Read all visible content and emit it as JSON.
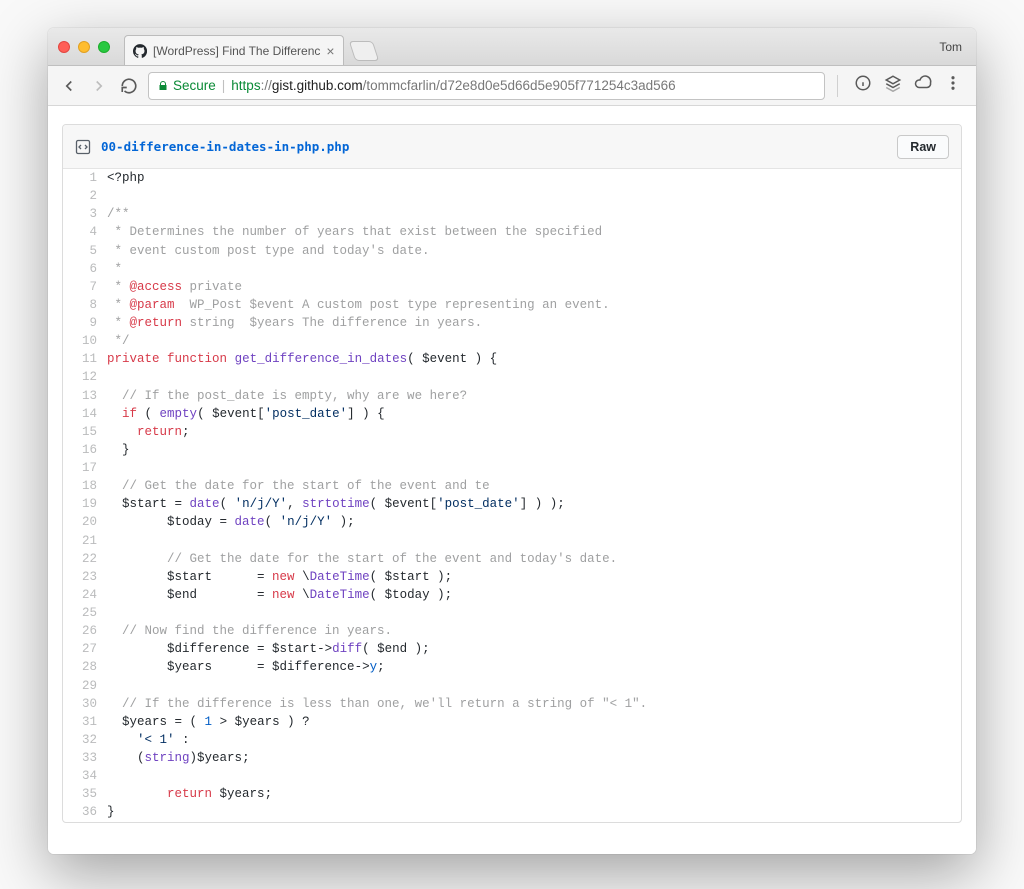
{
  "window": {
    "user_label": "Tom",
    "tabs": [
      {
        "title": "[WordPress] Find The Differenc"
      }
    ]
  },
  "toolbar": {
    "secure_label": "Secure",
    "url_https": "https",
    "url_host": "gist.github.com",
    "url_path": "/tommcfarlin/d72e8d0e5d66d5e905f771254c3ad566"
  },
  "gist": {
    "filename": "00-difference-in-dates-in-php.php",
    "raw_label": "Raw"
  },
  "code": {
    "language": "php",
    "plain": "<?php\n\n/**\n * Determines the number of years that exist between the specified\n * event custom post type and today's date.\n *\n * @access private\n * @param  WP_Post $event A custom post type representing an event.\n * @return string  $years The difference in years.\n */\nprivate function get_difference_in_dates( $event ) {\n\n  // If the post_date is empty, why are we here?\n  if ( empty( $event['post_date'] ) {\n    return;\n  }\n\n  // Get the date for the start of the event and te\n  $start = date( 'n/j/Y', strtotime( $event['post_date'] ) );\n        $today = date( 'n/j/Y' );\n\n        // Get the date for the start of the event and today's date.\n        $start      = new \\DateTime( $start );\n        $end        = new \\DateTime( $today );\n\n  // Now find the difference in years.\n        $difference = $start->diff( $end );\n        $years      = $difference->y;\n\n  // If the difference is less than one, we'll return a string of \"< 1\".\n  $years = ( 1 > $years ) ?\n    '< 1' :\n    (string)$years;\n\n        return $years;\n}\n",
    "lines": [
      {
        "n": 1,
        "tokens": [
          {
            "t": "<?php",
            "c": ""
          }
        ]
      },
      {
        "n": 2,
        "tokens": [
          {
            "t": "",
            "c": ""
          }
        ]
      },
      {
        "n": 3,
        "tokens": [
          {
            "t": "/**",
            "c": "c"
          }
        ]
      },
      {
        "n": 4,
        "tokens": [
          {
            "t": " * Determines the number of years that exist between the specified",
            "c": "c"
          }
        ]
      },
      {
        "n": 5,
        "tokens": [
          {
            "t": " * event custom post type and today's date.",
            "c": "c"
          }
        ]
      },
      {
        "n": 6,
        "tokens": [
          {
            "t": " *",
            "c": "c"
          }
        ]
      },
      {
        "n": 7,
        "tokens": [
          {
            "t": " * ",
            "c": "c"
          },
          {
            "t": "@access",
            "c": "tag"
          },
          {
            "t": " private",
            "c": "c"
          }
        ]
      },
      {
        "n": 8,
        "tokens": [
          {
            "t": " * ",
            "c": "c"
          },
          {
            "t": "@param",
            "c": "tag"
          },
          {
            "t": "  WP_Post $event A custom post type representing an event.",
            "c": "c"
          }
        ]
      },
      {
        "n": 9,
        "tokens": [
          {
            "t": " * ",
            "c": "c"
          },
          {
            "t": "@return",
            "c": "tag"
          },
          {
            "t": " string  $years The difference in years.",
            "c": "c"
          }
        ]
      },
      {
        "n": 10,
        "tokens": [
          {
            "t": " */",
            "c": "c"
          }
        ]
      },
      {
        "n": 11,
        "tokens": [
          {
            "t": "private",
            "c": "k"
          },
          {
            "t": " ",
            "c": ""
          },
          {
            "t": "function",
            "c": "k"
          },
          {
            "t": " ",
            "c": ""
          },
          {
            "t": "get_difference_in_dates",
            "c": "fn"
          },
          {
            "t": "( ",
            "c": ""
          },
          {
            "t": "$event",
            "c": "v"
          },
          {
            "t": " ) {",
            "c": ""
          }
        ]
      },
      {
        "n": 12,
        "tokens": [
          {
            "t": "",
            "c": ""
          }
        ]
      },
      {
        "n": 13,
        "tokens": [
          {
            "t": "  ",
            "c": ""
          },
          {
            "t": "// If the post_date is empty, why are we here?",
            "c": "c"
          }
        ]
      },
      {
        "n": 14,
        "tokens": [
          {
            "t": "  ",
            "c": ""
          },
          {
            "t": "if",
            "c": "k"
          },
          {
            "t": " ( ",
            "c": ""
          },
          {
            "t": "empty",
            "c": "fn"
          },
          {
            "t": "( ",
            "c": ""
          },
          {
            "t": "$event",
            "c": "v"
          },
          {
            "t": "[",
            "c": ""
          },
          {
            "t": "'post_date'",
            "c": "s"
          },
          {
            "t": "] ) {",
            "c": ""
          }
        ]
      },
      {
        "n": 15,
        "tokens": [
          {
            "t": "    ",
            "c": ""
          },
          {
            "t": "return",
            "c": "k"
          },
          {
            "t": ";",
            "c": ""
          }
        ]
      },
      {
        "n": 16,
        "tokens": [
          {
            "t": "  }",
            "c": ""
          }
        ]
      },
      {
        "n": 17,
        "tokens": [
          {
            "t": "",
            "c": ""
          }
        ]
      },
      {
        "n": 18,
        "tokens": [
          {
            "t": "  ",
            "c": ""
          },
          {
            "t": "// Get the date for the start of the event and te",
            "c": "c"
          }
        ]
      },
      {
        "n": 19,
        "tokens": [
          {
            "t": "  ",
            "c": ""
          },
          {
            "t": "$start",
            "c": "v"
          },
          {
            "t": " = ",
            "c": ""
          },
          {
            "t": "date",
            "c": "fn"
          },
          {
            "t": "( ",
            "c": ""
          },
          {
            "t": "'n/j/Y'",
            "c": "s"
          },
          {
            "t": ", ",
            "c": ""
          },
          {
            "t": "strtotime",
            "c": "fn"
          },
          {
            "t": "( ",
            "c": ""
          },
          {
            "t": "$event",
            "c": "v"
          },
          {
            "t": "[",
            "c": ""
          },
          {
            "t": "'post_date'",
            "c": "s"
          },
          {
            "t": "] ) );",
            "c": ""
          }
        ]
      },
      {
        "n": 20,
        "tokens": [
          {
            "t": "        ",
            "c": ""
          },
          {
            "t": "$today",
            "c": "v"
          },
          {
            "t": " = ",
            "c": ""
          },
          {
            "t": "date",
            "c": "fn"
          },
          {
            "t": "( ",
            "c": ""
          },
          {
            "t": "'n/j/Y'",
            "c": "s"
          },
          {
            "t": " );",
            "c": ""
          }
        ]
      },
      {
        "n": 21,
        "tokens": [
          {
            "t": "",
            "c": ""
          }
        ]
      },
      {
        "n": 22,
        "tokens": [
          {
            "t": "        ",
            "c": ""
          },
          {
            "t": "// Get the date for the start of the event and today's date.",
            "c": "c"
          }
        ]
      },
      {
        "n": 23,
        "tokens": [
          {
            "t": "        ",
            "c": ""
          },
          {
            "t": "$start",
            "c": "v"
          },
          {
            "t": "      = ",
            "c": ""
          },
          {
            "t": "new",
            "c": "k"
          },
          {
            "t": " \\",
            "c": ""
          },
          {
            "t": "DateTime",
            "c": "fn"
          },
          {
            "t": "( ",
            "c": ""
          },
          {
            "t": "$start",
            "c": "v"
          },
          {
            "t": " );",
            "c": ""
          }
        ]
      },
      {
        "n": 24,
        "tokens": [
          {
            "t": "        ",
            "c": ""
          },
          {
            "t": "$end",
            "c": "v"
          },
          {
            "t": "        = ",
            "c": ""
          },
          {
            "t": "new",
            "c": "k"
          },
          {
            "t": " \\",
            "c": ""
          },
          {
            "t": "DateTime",
            "c": "fn"
          },
          {
            "t": "( ",
            "c": ""
          },
          {
            "t": "$today",
            "c": "v"
          },
          {
            "t": " );",
            "c": ""
          }
        ]
      },
      {
        "n": 25,
        "tokens": [
          {
            "t": "",
            "c": ""
          }
        ]
      },
      {
        "n": 26,
        "tokens": [
          {
            "t": "  ",
            "c": ""
          },
          {
            "t": "// Now find the difference in years.",
            "c": "c"
          }
        ]
      },
      {
        "n": 27,
        "tokens": [
          {
            "t": "        ",
            "c": ""
          },
          {
            "t": "$difference",
            "c": "v"
          },
          {
            "t": " = ",
            "c": ""
          },
          {
            "t": "$start",
            "c": "v"
          },
          {
            "t": "->",
            "c": "op"
          },
          {
            "t": "diff",
            "c": "fn"
          },
          {
            "t": "( ",
            "c": ""
          },
          {
            "t": "$end",
            "c": "v"
          },
          {
            "t": " );",
            "c": ""
          }
        ]
      },
      {
        "n": 28,
        "tokens": [
          {
            "t": "        ",
            "c": ""
          },
          {
            "t": "$years",
            "c": "v"
          },
          {
            "t": "      = ",
            "c": ""
          },
          {
            "t": "$difference",
            "c": "v"
          },
          {
            "t": "->",
            "c": "op"
          },
          {
            "t": "y",
            "c": "prop"
          },
          {
            "t": ";",
            "c": ""
          }
        ]
      },
      {
        "n": 29,
        "tokens": [
          {
            "t": "",
            "c": ""
          }
        ]
      },
      {
        "n": 30,
        "tokens": [
          {
            "t": "  ",
            "c": ""
          },
          {
            "t": "// If the difference is less than one, we'll return a string of \"< 1\".",
            "c": "c"
          }
        ]
      },
      {
        "n": 31,
        "tokens": [
          {
            "t": "  ",
            "c": ""
          },
          {
            "t": "$years",
            "c": "v"
          },
          {
            "t": " = ( ",
            "c": ""
          },
          {
            "t": "1",
            "c": "num"
          },
          {
            "t": " > ",
            "c": ""
          },
          {
            "t": "$years",
            "c": "v"
          },
          {
            "t": " ) ?",
            "c": ""
          }
        ]
      },
      {
        "n": 32,
        "tokens": [
          {
            "t": "    ",
            "c": ""
          },
          {
            "t": "'< 1'",
            "c": "s"
          },
          {
            "t": " :",
            "c": ""
          }
        ]
      },
      {
        "n": 33,
        "tokens": [
          {
            "t": "    (",
            "c": ""
          },
          {
            "t": "string",
            "c": "fn"
          },
          {
            "t": ")",
            "c": ""
          },
          {
            "t": "$years",
            "c": "v"
          },
          {
            "t": ";",
            "c": ""
          }
        ]
      },
      {
        "n": 34,
        "tokens": [
          {
            "t": "",
            "c": ""
          }
        ]
      },
      {
        "n": 35,
        "tokens": [
          {
            "t": "        ",
            "c": ""
          },
          {
            "t": "return",
            "c": "k"
          },
          {
            "t": " ",
            "c": ""
          },
          {
            "t": "$years",
            "c": "v"
          },
          {
            "t": ";",
            "c": ""
          }
        ]
      },
      {
        "n": 36,
        "tokens": [
          {
            "t": "}",
            "c": ""
          }
        ]
      }
    ]
  }
}
